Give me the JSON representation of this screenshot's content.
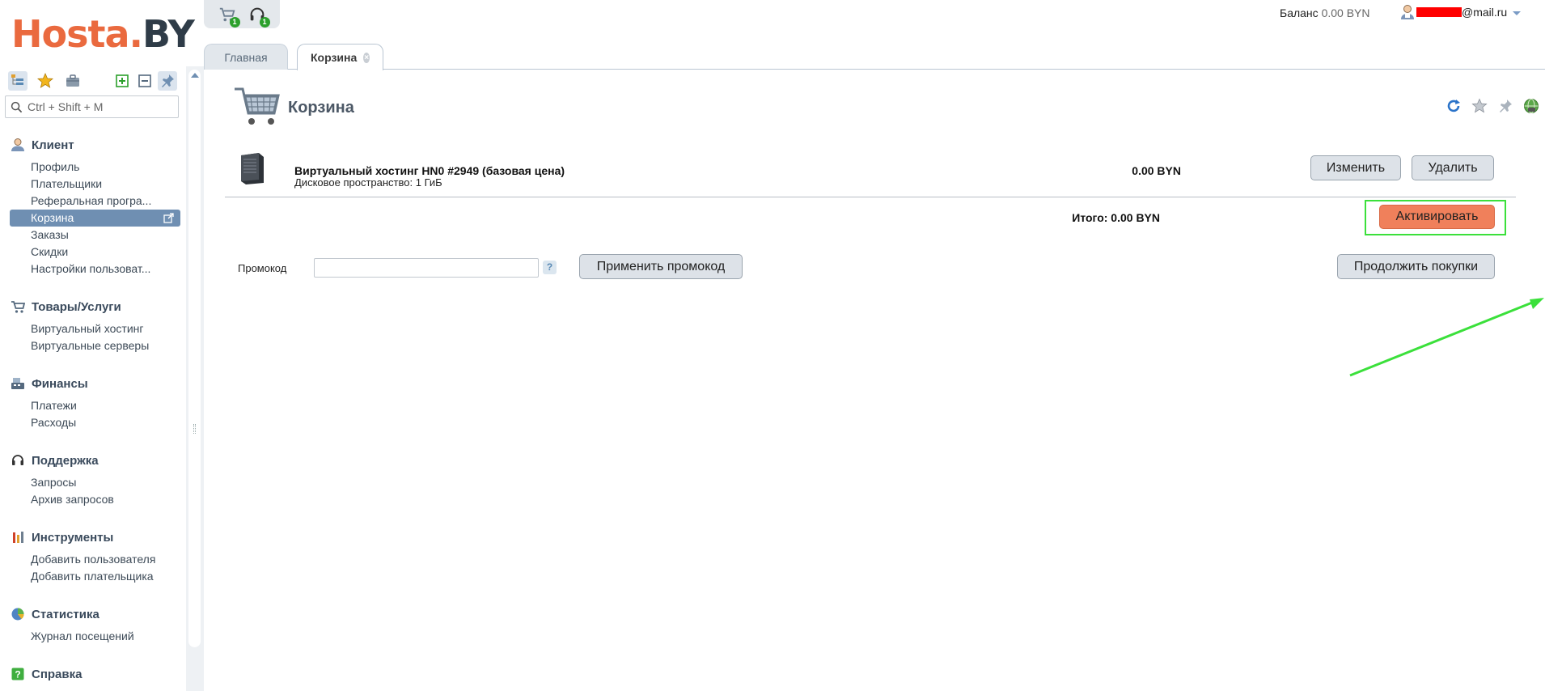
{
  "logo": {
    "part1": "Hosta.",
    "part2": "BY"
  },
  "quick_panel": {
    "cart_badge": "1",
    "support_badge": "1"
  },
  "header": {
    "balance_label": "Баланс",
    "balance_value": "0.00 BYN",
    "user_email_suffix": "@mail.ru"
  },
  "sidebar": {
    "search_placeholder": "Ctrl + Shift + M",
    "groups": [
      {
        "title": "Клиент",
        "icon": "user-icon",
        "items": [
          "Профиль",
          "Плательщики",
          "Реферальная програ...",
          "Корзина",
          "Заказы",
          "Скидки",
          "Настройки пользоват..."
        ]
      },
      {
        "title": "Товары/Услуги",
        "icon": "cart-icon",
        "items": [
          "Виртуальный хостинг",
          "Виртуальные серверы"
        ]
      },
      {
        "title": "Финансы",
        "icon": "cash-register-icon",
        "items": [
          "Платежи",
          "Расходы"
        ]
      },
      {
        "title": "Поддержка",
        "icon": "headset-icon",
        "items": [
          "Запросы",
          "Архив запросов"
        ]
      },
      {
        "title": "Инструменты",
        "icon": "tools-icon",
        "items": [
          "Добавить пользователя",
          "Добавить плательщика"
        ]
      },
      {
        "title": "Статистика",
        "icon": "pie-chart-icon",
        "items": [
          "Журнал посещений"
        ]
      },
      {
        "title": "Справка",
        "icon": "help-icon",
        "items": []
      }
    ],
    "selected_item": "Корзина"
  },
  "tabs": [
    {
      "label": "Главная",
      "active": false
    },
    {
      "label": "Корзина",
      "active": true
    }
  ],
  "page": {
    "title": "Корзина",
    "item": {
      "title": "Виртуальный хостинг HN0 #2949 (базовая цена)",
      "subtitle": "Дисковое пространство: 1 ГиБ",
      "price": "0.00 BYN",
      "edit_label": "Изменить",
      "delete_label": "Удалить"
    },
    "total": "Итого: 0.00 BYN",
    "activate_label": "Активировать",
    "promo": {
      "label": "Промокод",
      "value": "",
      "help": "?",
      "apply_label": "Применить промокод"
    },
    "continue_label": "Продолжить покупки"
  },
  "colors": {
    "accent_orange": "#f0805b",
    "selection_blue": "#6f8fb2",
    "highlight_green": "#3be03b"
  }
}
